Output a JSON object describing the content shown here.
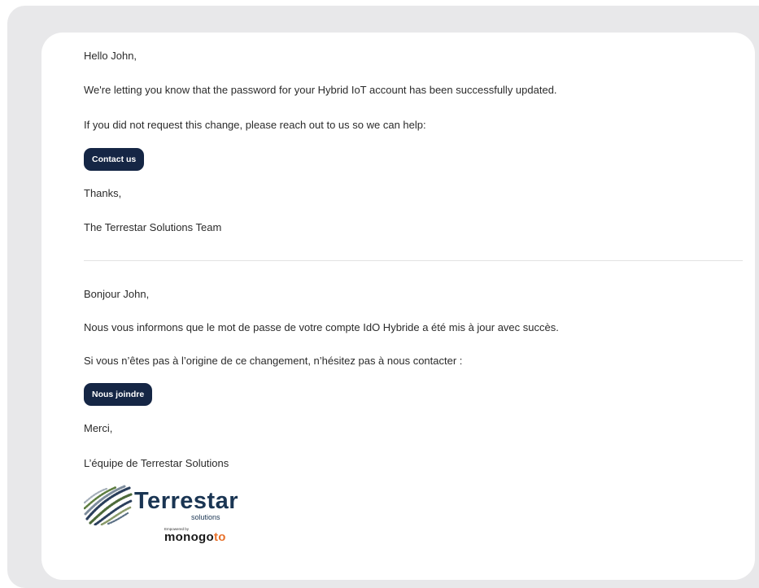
{
  "email": {
    "en": {
      "greeting": "Hello John,",
      "line1": "We're letting you know that the password for your Hybrid IoT account has been successfully updated.",
      "line2": "If you did not request this change, please reach out to us so we can help:",
      "button_label": "Contact us",
      "thanks": "Thanks,",
      "signoff": "The Terrestar Solutions Team"
    },
    "fr": {
      "greeting": "Bonjour John,",
      "line1": "Nous vous informons que le mot de passe de votre compte IdO Hybride a été mis à jour avec succès.",
      "line2": "Si vous n’êtes pas à l’origine de ce changement, n’hésitez pas à nous contacter :",
      "button_label": "Nous joindre",
      "thanks": "Merci,",
      "signoff": "L’équipe de Terrestar Solutions"
    }
  },
  "logo": {
    "wordmark": "Terrestar",
    "subtitle": "solutions",
    "powered_by": "Empowered by",
    "brand_main": "monogo",
    "brand_accent": "to",
    "icon": "terrestar-globe-icon"
  },
  "colors": {
    "background": "#e8e8ea",
    "card": "#ffffff",
    "button": "#152645",
    "text": "#2b2b2b",
    "brand": "#1a3553",
    "accent": "#e8712b"
  }
}
